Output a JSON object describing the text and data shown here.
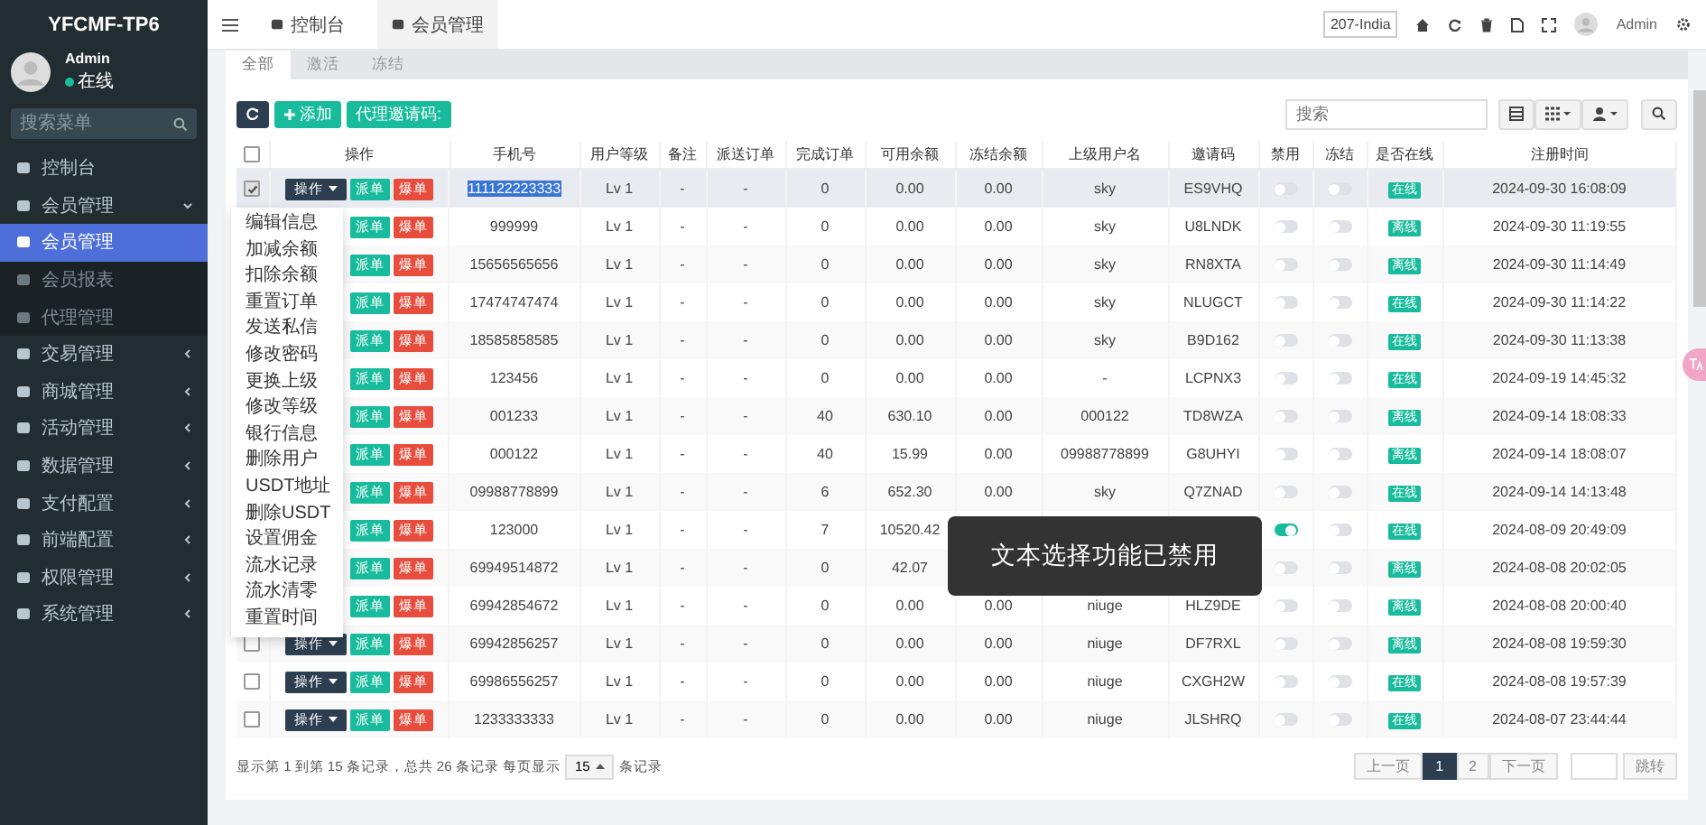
{
  "sidebar": {
    "brand": "YFCMF-TP6",
    "user": {
      "name": "Admin",
      "status": "在线"
    },
    "search": {
      "placeholder": "搜索菜单"
    },
    "items": [
      {
        "label": "控制台",
        "kind": "link"
      },
      {
        "label": "会员管理",
        "kind": "group",
        "expanded": true,
        "children": [
          {
            "label": "会员管理",
            "selected": true
          },
          {
            "label": "会员报表",
            "selected": false
          },
          {
            "label": "代理管理",
            "selected": false
          }
        ]
      },
      {
        "label": "交易管理",
        "kind": "group",
        "expanded": false
      },
      {
        "label": "商城管理",
        "kind": "group",
        "expanded": false
      },
      {
        "label": "活动管理",
        "kind": "group",
        "expanded": false
      },
      {
        "label": "数据管理",
        "kind": "group",
        "expanded": false
      },
      {
        "label": "支付配置",
        "kind": "group",
        "expanded": false
      },
      {
        "label": "前端配置",
        "kind": "group",
        "expanded": false
      },
      {
        "label": "权限管理",
        "kind": "group",
        "expanded": false
      },
      {
        "label": "系统管理",
        "kind": "group",
        "expanded": false
      }
    ]
  },
  "topbar": {
    "tabs": [
      {
        "label": "控制台",
        "selected": false
      },
      {
        "label": "会员管理",
        "selected": true
      }
    ],
    "region": "207-India",
    "user": "Admin"
  },
  "subtabs": [
    {
      "label": "全部",
      "selected": true
    },
    {
      "label": "激活",
      "selected": false
    },
    {
      "label": "冻结",
      "selected": false
    }
  ],
  "toolbar": {
    "add_button": "添加",
    "invite_button": "代理邀请码:",
    "search": {
      "placeholder": "搜索"
    }
  },
  "table": {
    "columns": [
      "操作",
      "手机号",
      "用户等级",
      "备注",
      "派送订单",
      "完成订单",
      "可用余额",
      "冻结余额",
      "上级用户名",
      "邀请码",
      "禁用",
      "冻结",
      "是否在线",
      "注册时间"
    ],
    "select_all": {
      "checked": false
    },
    "rows": [
      {
        "select": {
          "checked": true
        },
        "op_button": "操作",
        "dispatch": "派单",
        "burst": "爆单",
        "phone": "111122223333",
        "phone_highlighted": true,
        "level": "Lv 1",
        "remark": "-",
        "dispatched": "-",
        "completed": "0",
        "balance": "0.00",
        "frozen_balance": "0.00",
        "upline": "sky",
        "invite": "ES9VHQ",
        "banned": false,
        "frozen": false,
        "status": "在线",
        "registered": "2024-09-30 16:08:09"
      },
      {
        "dispatch": "派单",
        "burst": "爆单",
        "phone": "999999",
        "phone_highlighted": false,
        "level": "Lv 1",
        "remark": "-",
        "dispatched": "-",
        "completed": "0",
        "balance": "0.00",
        "frozen_balance": "0.00",
        "upline": "sky",
        "invite": "U8LNDK",
        "banned": false,
        "frozen": false,
        "status": "离线",
        "registered": "2024-09-30 11:19:55"
      },
      {
        "dispatch": "派单",
        "burst": "爆单",
        "phone": "15656565656",
        "phone_highlighted": false,
        "level": "Lv 1",
        "remark": "-",
        "dispatched": "-",
        "completed": "0",
        "balance": "0.00",
        "frozen_balance": "0.00",
        "upline": "sky",
        "invite": "RN8XTA",
        "banned": false,
        "frozen": false,
        "status": "离线",
        "registered": "2024-09-30 11:14:49"
      },
      {
        "dispatch": "派单",
        "burst": "爆单",
        "phone": "17474747474",
        "phone_highlighted": false,
        "level": "Lv 1",
        "remark": "-",
        "dispatched": "-",
        "completed": "0",
        "balance": "0.00",
        "frozen_balance": "0.00",
        "upline": "sky",
        "invite": "NLUGCT",
        "banned": false,
        "frozen": false,
        "status": "在线",
        "registered": "2024-09-30 11:14:22"
      },
      {
        "dispatch": "派单",
        "burst": "爆单",
        "phone": "18585858585",
        "phone_highlighted": false,
        "level": "Lv 1",
        "remark": "-",
        "dispatched": "-",
        "completed": "0",
        "balance": "0.00",
        "frozen_balance": "0.00",
        "upline": "sky",
        "invite": "B9D162",
        "banned": false,
        "frozen": false,
        "status": "在线",
        "registered": "2024-09-30 11:13:38"
      },
      {
        "dispatch": "派单",
        "burst": "爆单",
        "phone": "123456",
        "phone_highlighted": false,
        "level": "Lv 1",
        "remark": "-",
        "dispatched": "-",
        "completed": "0",
        "balance": "0.00",
        "frozen_balance": "0.00",
        "upline": "-",
        "invite": "LCPNX3",
        "banned": false,
        "frozen": false,
        "status": "在线",
        "registered": "2024-09-19 14:45:32"
      },
      {
        "dispatch": "派单",
        "burst": "爆单",
        "phone": "001233",
        "phone_highlighted": false,
        "level": "Lv 1",
        "remark": "-",
        "dispatched": "-",
        "completed": "40",
        "balance": "630.10",
        "frozen_balance": "0.00",
        "upline": "000122",
        "invite": "TD8WZA",
        "banned": false,
        "frozen": false,
        "status": "离线",
        "registered": "2024-09-14 18:08:33"
      },
      {
        "dispatch": "派单",
        "burst": "爆单",
        "phone": "000122",
        "phone_highlighted": false,
        "level": "Lv 1",
        "remark": "-",
        "dispatched": "-",
        "completed": "40",
        "balance": "15.99",
        "frozen_balance": "0.00",
        "upline": "09988778899",
        "invite": "G8UHYI",
        "banned": false,
        "frozen": false,
        "status": "离线",
        "registered": "2024-09-14 18:08:07"
      },
      {
        "dispatch": "派单",
        "burst": "爆单",
        "phone": "09988778899",
        "phone_highlighted": false,
        "level": "Lv 1",
        "remark": "-",
        "dispatched": "-",
        "completed": "6",
        "balance": "652.30",
        "frozen_balance": "0.00",
        "upline": "sky",
        "invite": "Q7ZNAD",
        "banned": false,
        "frozen": false,
        "status": "在线",
        "registered": "2024-09-14 14:13:48"
      },
      {
        "dispatch": "派单",
        "burst": "爆单",
        "phone": "123000",
        "phone_highlighted": false,
        "level": "Lv 1",
        "remark": "-",
        "dispatched": "-",
        "completed": "7",
        "balance": "10520.42",
        "banned": true,
        "frozen": false,
        "status": "在线",
        "registered": "2024-08-09 20:49:09"
      },
      {
        "dispatch": "派单",
        "burst": "爆单",
        "phone": "69949514872",
        "phone_highlighted": false,
        "level": "Lv 1",
        "remark": "-",
        "dispatched": "-",
        "completed": "0",
        "balance": "42.07",
        "banned": false,
        "frozen": false,
        "status": "离线",
        "registered": "2024-08-08 20:02:05"
      },
      {
        "dispatch": "派单",
        "burst": "爆单",
        "phone": "69942854672",
        "phone_highlighted": false,
        "level": "Lv 1",
        "remark": "-",
        "dispatched": "-",
        "completed": "0",
        "balance": "0.00",
        "frozen_balance": "0.00",
        "upline": "niuge",
        "invite": "HLZ9DE",
        "banned": false,
        "frozen": false,
        "status": "离线",
        "registered": "2024-08-08 20:00:40"
      },
      {
        "select": {
          "checked": false
        },
        "op_button": "操作",
        "dispatch": "派单",
        "burst": "爆单",
        "phone": "69942856257",
        "phone_highlighted": false,
        "level": "Lv 1",
        "remark": "-",
        "dispatched": "-",
        "completed": "0",
        "balance": "0.00",
        "frozen_balance": "0.00",
        "upline": "niuge",
        "invite": "DF7RXL",
        "banned": false,
        "frozen": false,
        "status": "离线",
        "registered": "2024-08-08 19:59:30"
      },
      {
        "select": {
          "checked": false
        },
        "op_button": "操作",
        "dispatch": "派单",
        "burst": "爆单",
        "phone": "69986556257",
        "phone_highlighted": false,
        "level": "Lv 1",
        "remark": "-",
        "dispatched": "-",
        "completed": "0",
        "balance": "0.00",
        "frozen_balance": "0.00",
        "upline": "niuge",
        "invite": "CXGH2W",
        "banned": false,
        "frozen": false,
        "status": "在线",
        "registered": "2024-08-08 19:57:39"
      },
      {
        "select": {
          "checked": false
        },
        "op_button": "操作",
        "dispatch": "派单",
        "burst": "爆单",
        "phone": "1233333333",
        "phone_highlighted": false,
        "level": "Lv 1",
        "remark": "-",
        "dispatched": "-",
        "completed": "0",
        "balance": "0.00",
        "frozen_balance": "0.00",
        "upline": "niuge",
        "invite": "JLSHRQ",
        "banned": false,
        "frozen": false,
        "status": "在线",
        "registered": "2024-08-07 23:44:44"
      }
    ]
  },
  "action_menu": [
    "编辑信息",
    "加减余额",
    "扣除余额",
    "重置订单",
    "发送私信",
    "修改密码",
    "更换上级",
    "修改等级",
    "银行信息",
    "删除用户",
    "USDT地址",
    "删除USDT",
    "设置佣金",
    "流水记录",
    "流水清零",
    "重置时间"
  ],
  "footer": {
    "summary": "显示第 1 到第 15 条记录，总共 26 条记录 每页显示",
    "page_size": "15",
    "unit": "条记录"
  },
  "pagination": {
    "prev": "上一页",
    "pages": [
      {
        "label": "1",
        "selected": true
      },
      {
        "label": "2",
        "selected": false
      }
    ],
    "next": "下一页",
    "go": "跳转"
  },
  "toast": "文本选择功能已禁用"
}
